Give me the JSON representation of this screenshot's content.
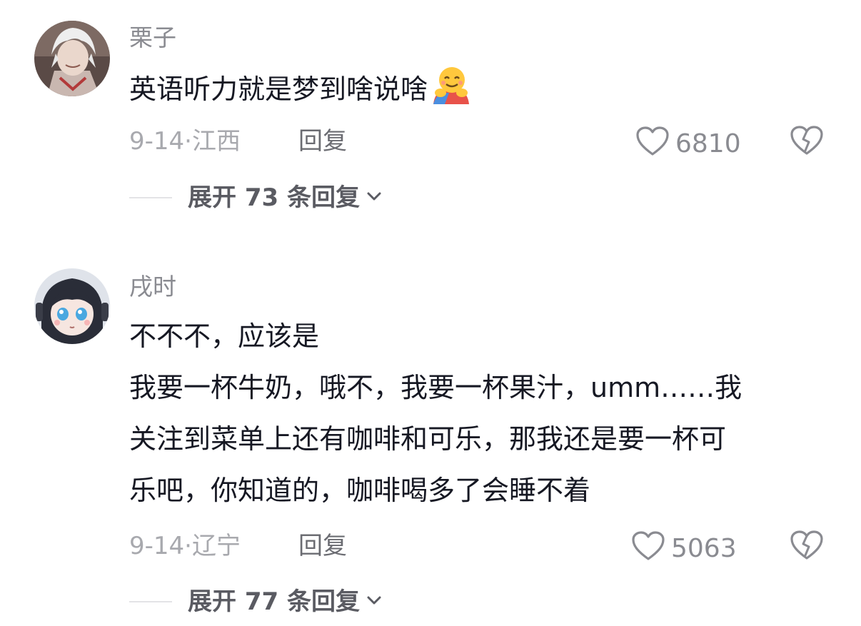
{
  "comments": [
    {
      "username": "栗子",
      "text_lines": [
        "英语听力就是梦到啥说啥"
      ],
      "emoji": "hugging-face-emoji",
      "date": "9-14",
      "location": "江西",
      "reply_label": "回复",
      "likes": "6810",
      "expand_label": "展开 73 条回复"
    },
    {
      "username": "戌时",
      "text_lines": [
        "不不不，应该是",
        "我要一杯牛奶，哦不，我要一杯果汁，umm……我",
        "关注到菜单上还有咖啡和可乐，那我还是要一杯可",
        "乐吧，你知道的，咖啡喝多了会睡不着"
      ],
      "date": "9-14",
      "location": "辽宁",
      "reply_label": "回复",
      "likes": "5063",
      "expand_label": "展开 77 条回复"
    }
  ],
  "meta_separator": "·",
  "icons": {
    "like": "heart-outline-icon",
    "dislike": "broken-heart-icon",
    "expand": "chevron-down-icon"
  },
  "colors": {
    "text": "#161823",
    "username": "#8a8b91",
    "meta": "#a8a9ae",
    "expand": "#5a5b62"
  }
}
